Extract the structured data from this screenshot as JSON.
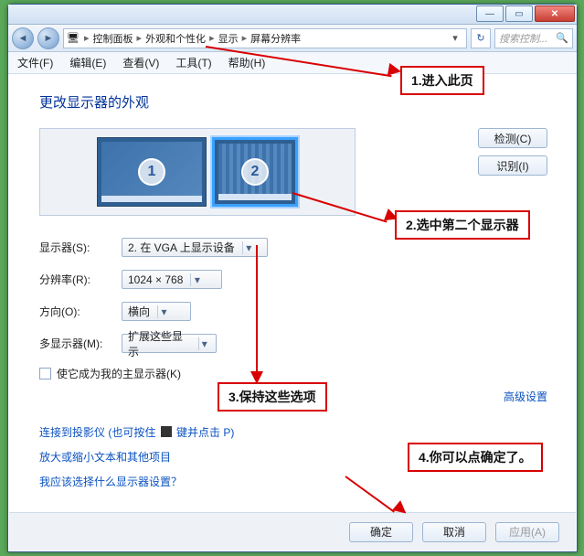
{
  "window": {
    "breadcrumbs": [
      "控制面板",
      "外观和个性化",
      "显示",
      "屏幕分辨率"
    ],
    "search_placeholder": "搜索控制..."
  },
  "menubar": [
    "文件(F)",
    "编辑(E)",
    "查看(V)",
    "工具(T)",
    "帮助(H)"
  ],
  "heading": "更改显示器的外观",
  "monitors": {
    "m1_label": "1",
    "m2_label": "2"
  },
  "side_buttons": {
    "detect": "检测(C)",
    "identify": "识别(I)"
  },
  "form": {
    "display_label": "显示器(S):",
    "display_value": "2. 在 VGA 上显示设备",
    "resolution_label": "分辨率(R):",
    "resolution_value": "1024 × 768",
    "orientation_label": "方向(O):",
    "orientation_value": "横向",
    "multi_label": "多显示器(M):",
    "multi_value": "扩展这些显示"
  },
  "checkbox_label": "使它成为我的主显示器(K)",
  "advanced_link": "高级设置",
  "links": {
    "projector_a": "连接到投影仪 (也可按住 ",
    "projector_b": " 键并点击 P)",
    "zoom_text": "放大或缩小文本和其他项目",
    "which_settings": "我应该选择什么显示器设置？"
  },
  "buttons": {
    "ok": "确定",
    "cancel": "取消",
    "apply": "应用(A)"
  },
  "callouts": {
    "c1": "1.进入此页",
    "c2": "2.选中第二个显示器",
    "c3": "3.保持这些选项",
    "c4": "4.你可以点确定了。"
  }
}
